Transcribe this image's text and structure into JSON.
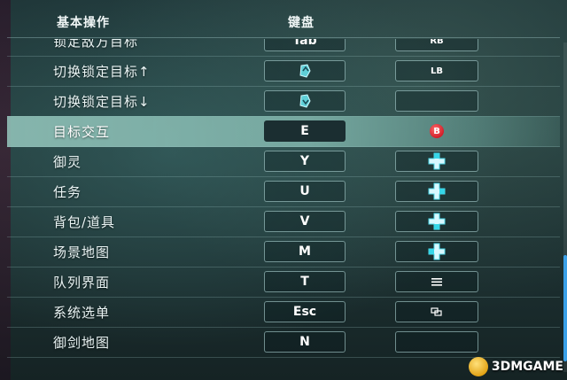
{
  "header": {
    "col_action": "基本操作",
    "col_keyboard": "键盘"
  },
  "rows": [
    {
      "label": "锁定敌方目标",
      "key": "Tab",
      "pad": "RB",
      "pad_type": "text",
      "partial": true
    },
    {
      "label": "切换锁定目标↑",
      "key": "",
      "key_icon": "mouse-wheel-up-icon",
      "pad": "LB",
      "pad_type": "text"
    },
    {
      "label": "切换锁定目标↓",
      "key": "",
      "key_icon": "mouse-wheel-down-icon",
      "pad": "",
      "pad_type": "empty"
    },
    {
      "label": "目标交互",
      "key": "E",
      "pad": "B",
      "pad_type": "b-button",
      "highlighted": true
    },
    {
      "label": "御灵",
      "key": "Y",
      "pad_icon": "dpad-up-icon",
      "pad_type": "dpad"
    },
    {
      "label": "任务",
      "key": "U",
      "pad_icon": "dpad-right-icon",
      "pad_type": "dpad"
    },
    {
      "label": "背包/道具",
      "key": "V",
      "pad_icon": "dpad-down-icon",
      "pad_type": "dpad"
    },
    {
      "label": "场景地图",
      "key": "M",
      "pad_icon": "dpad-left-icon",
      "pad_type": "dpad"
    },
    {
      "label": "队列界面",
      "key": "T",
      "pad_icon": "menu-icon",
      "pad_type": "menu"
    },
    {
      "label": "系统选单",
      "key": "Esc",
      "pad_icon": "view-icon",
      "pad_type": "view"
    },
    {
      "label": "御剑地图",
      "key": "N",
      "pad": "",
      "pad_type": "empty"
    }
  ],
  "watermark": {
    "text": "3DMGAME"
  },
  "scroll": {
    "position": 0.75
  },
  "colors": {
    "highlight": "#8cc3b9",
    "scroll_thumb": "#3aa0e8",
    "b_button": "#d11f2a",
    "dpad_glow": "#36d6e8"
  }
}
